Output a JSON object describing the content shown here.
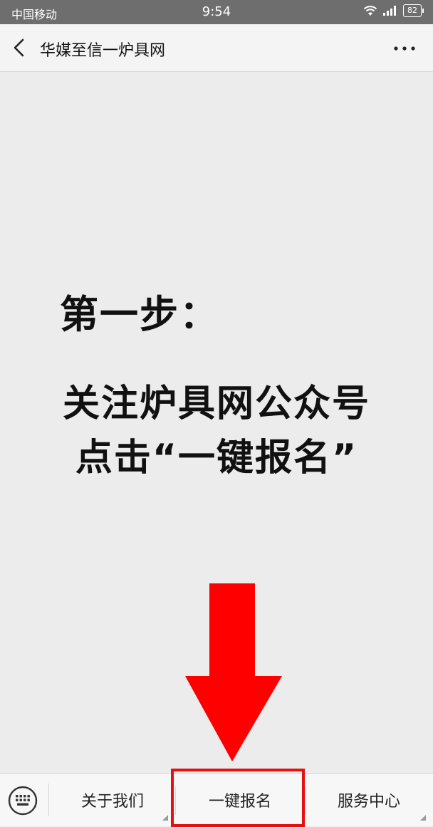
{
  "status_bar": {
    "carrier": "中国移动",
    "time": "9:54",
    "battery": "82"
  },
  "nav": {
    "title": "华媒至信一炉具网"
  },
  "content": {
    "step_title": "第一步：",
    "line1": "关注炉具网公众号",
    "line2": "点击“一键报名”"
  },
  "menu": {
    "items": [
      {
        "label": "关于我们"
      },
      {
        "label": "一键报名"
      },
      {
        "label": "服务中心"
      }
    ]
  },
  "colors": {
    "arrow": "#ff0000",
    "highlight": "#e61010",
    "status_bar_bg": "#6e6e6e"
  },
  "icons": {
    "back": "chevron-left-icon",
    "more": "more-dots-icon",
    "keyboard": "keyboard-icon",
    "wifi": "wifi-icon",
    "signal": "signal-icon",
    "battery": "battery-icon",
    "arrow": "down-arrow-icon"
  }
}
